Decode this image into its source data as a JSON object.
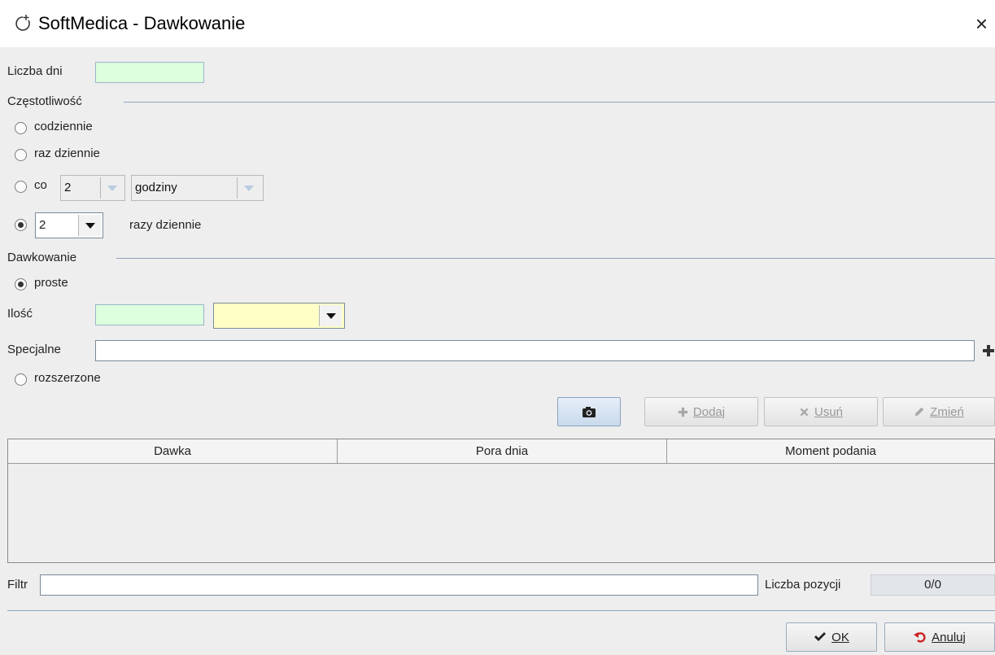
{
  "window": {
    "title": "SoftMedica - Dawkowanie",
    "close_glyph": "×"
  },
  "days": {
    "label": "Liczba dni",
    "value": ""
  },
  "frequency": {
    "section_label": "Częstotliwość",
    "daily_label": "codziennie",
    "once_daily_label": "raz dziennie",
    "every_label": "co",
    "every_value": "2",
    "every_unit": "godziny",
    "times_value": "2",
    "times_label": "razy dziennie",
    "selected": "times_per_day"
  },
  "dosing": {
    "section_label": "Dawkowanie",
    "simple_label": "proste",
    "amount_label": "Ilość",
    "amount_value": "",
    "unit_value": "",
    "special_label": "Specjalne",
    "special_value": "",
    "extended_label": "rozszerzone",
    "selected": "simple"
  },
  "toolbar": {
    "camera_icon": "camera-icon",
    "add_label": "Dodaj",
    "remove_label": "Usuń",
    "edit_label": "Zmień"
  },
  "table": {
    "columns": [
      "Dawka",
      "Pora dnia",
      "Moment podania"
    ],
    "rows": []
  },
  "filter": {
    "label": "Filtr",
    "value": ""
  },
  "count": {
    "label": "Liczba pozycji",
    "value": "0/0"
  },
  "footer": {
    "ok_label": "OK",
    "cancel_label": "Anuluj"
  },
  "colors": {
    "required_field": "#ddffdd",
    "unit_field": "#ffffc6",
    "separator": "#8ea3bf"
  }
}
